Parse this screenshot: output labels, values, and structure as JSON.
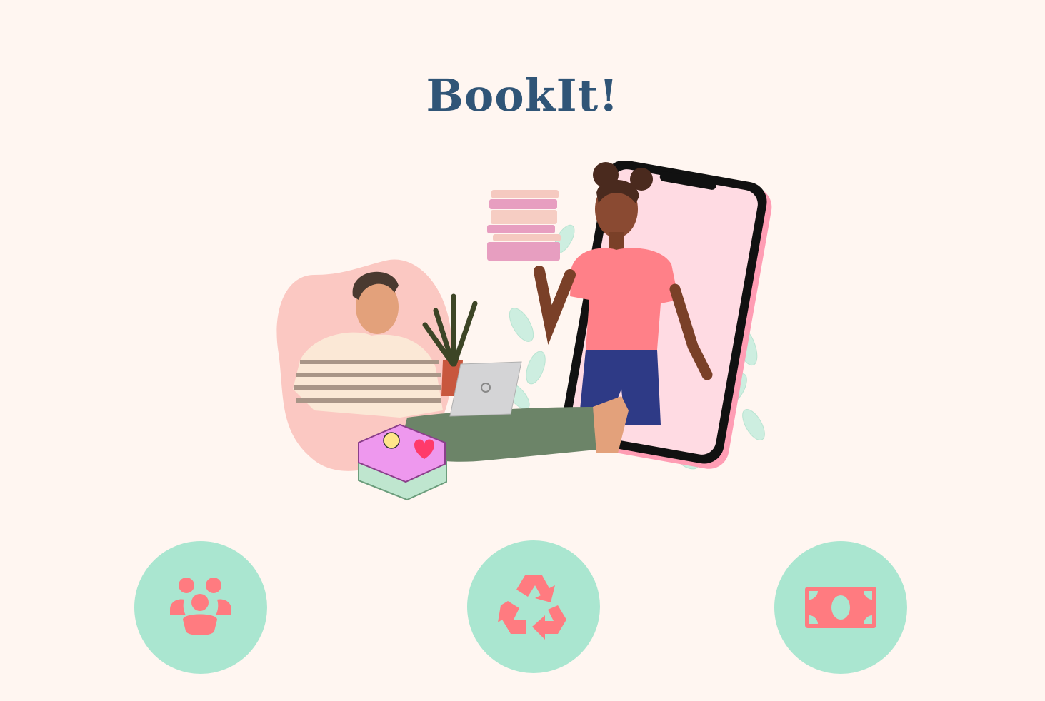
{
  "title": "BookIt!",
  "colors": {
    "background": "#fff6f1",
    "title": "#305577",
    "feature_circle": "#aae6d0",
    "feature_icon": "#ff7b80"
  },
  "hero": {
    "image": "illustration-people-sharing-books"
  },
  "features": [
    {
      "icon": "community-icon"
    },
    {
      "icon": "recycle-icon"
    },
    {
      "icon": "money-icon"
    }
  ]
}
